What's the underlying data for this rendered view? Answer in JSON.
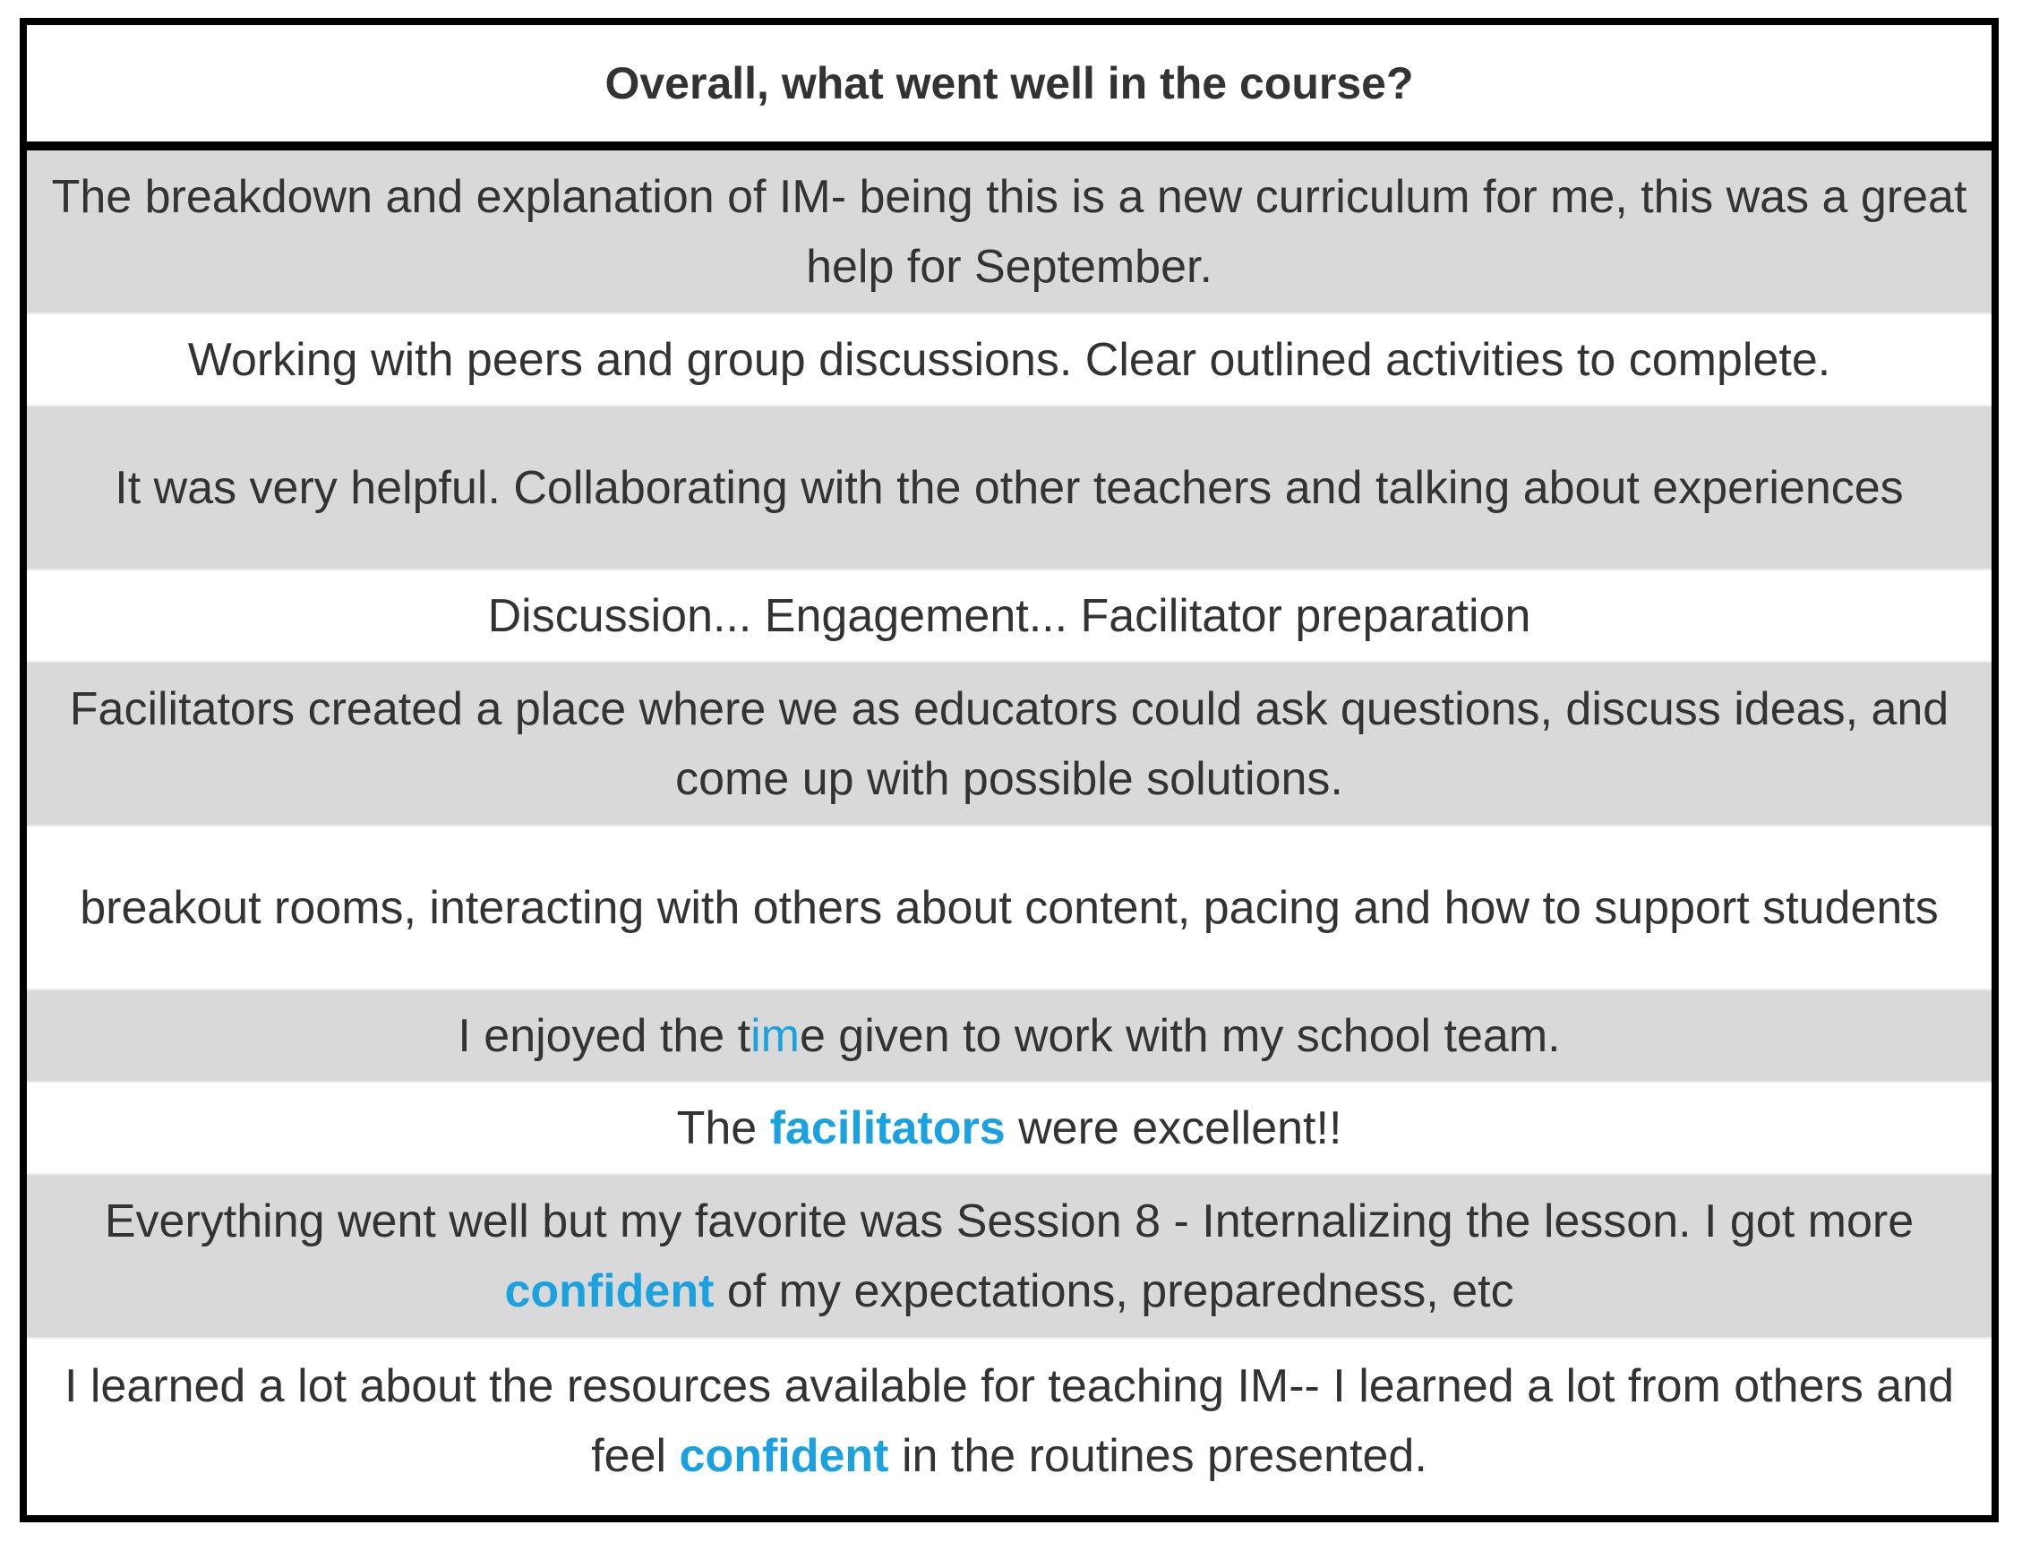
{
  "header": {
    "title": "Overall, what went well in the course?"
  },
  "colors": {
    "highlight": "#1aa1e0",
    "shaded_row": "#d9d9d9",
    "border": "#000000",
    "text": "#333333"
  },
  "responses": [
    {
      "text": "The breakdown and explanation of IM- being this is a new curriculum for me, this was a great help for September."
    },
    {
      "text": "Working with peers and group discussions. Clear outlined activities to complete."
    },
    {
      "text": "It was very helpful. Collaborating with the other teachers and talking about experiences"
    },
    {
      "text": "Discussion... Engagement... Facilitator preparation"
    },
    {
      "text": "Facilitators created a place where we as educators could ask questions, discuss ideas, and come up with possible solutions."
    },
    {
      "text": "breakout rooms, interacting with others about content, pacing and how to support students"
    },
    {
      "pre": "I enjoyed the t",
      "highlight": "im",
      "post": "e given to work with my school team."
    },
    {
      "pre": "The ",
      "highlight": "facilitators",
      "post": " were excellent!!"
    },
    {
      "pre": "Everything went well but my favorite was Session 8 - Internalizing the lesson. I got more ",
      "highlight": "confident",
      "post": " of my expectations, preparedness, etc"
    },
    {
      "pre": "I learned a lot about the resources available for teaching IM-- I learned a lot from others and feel ",
      "highlight": "confident",
      "post": " in the routines presented."
    }
  ]
}
